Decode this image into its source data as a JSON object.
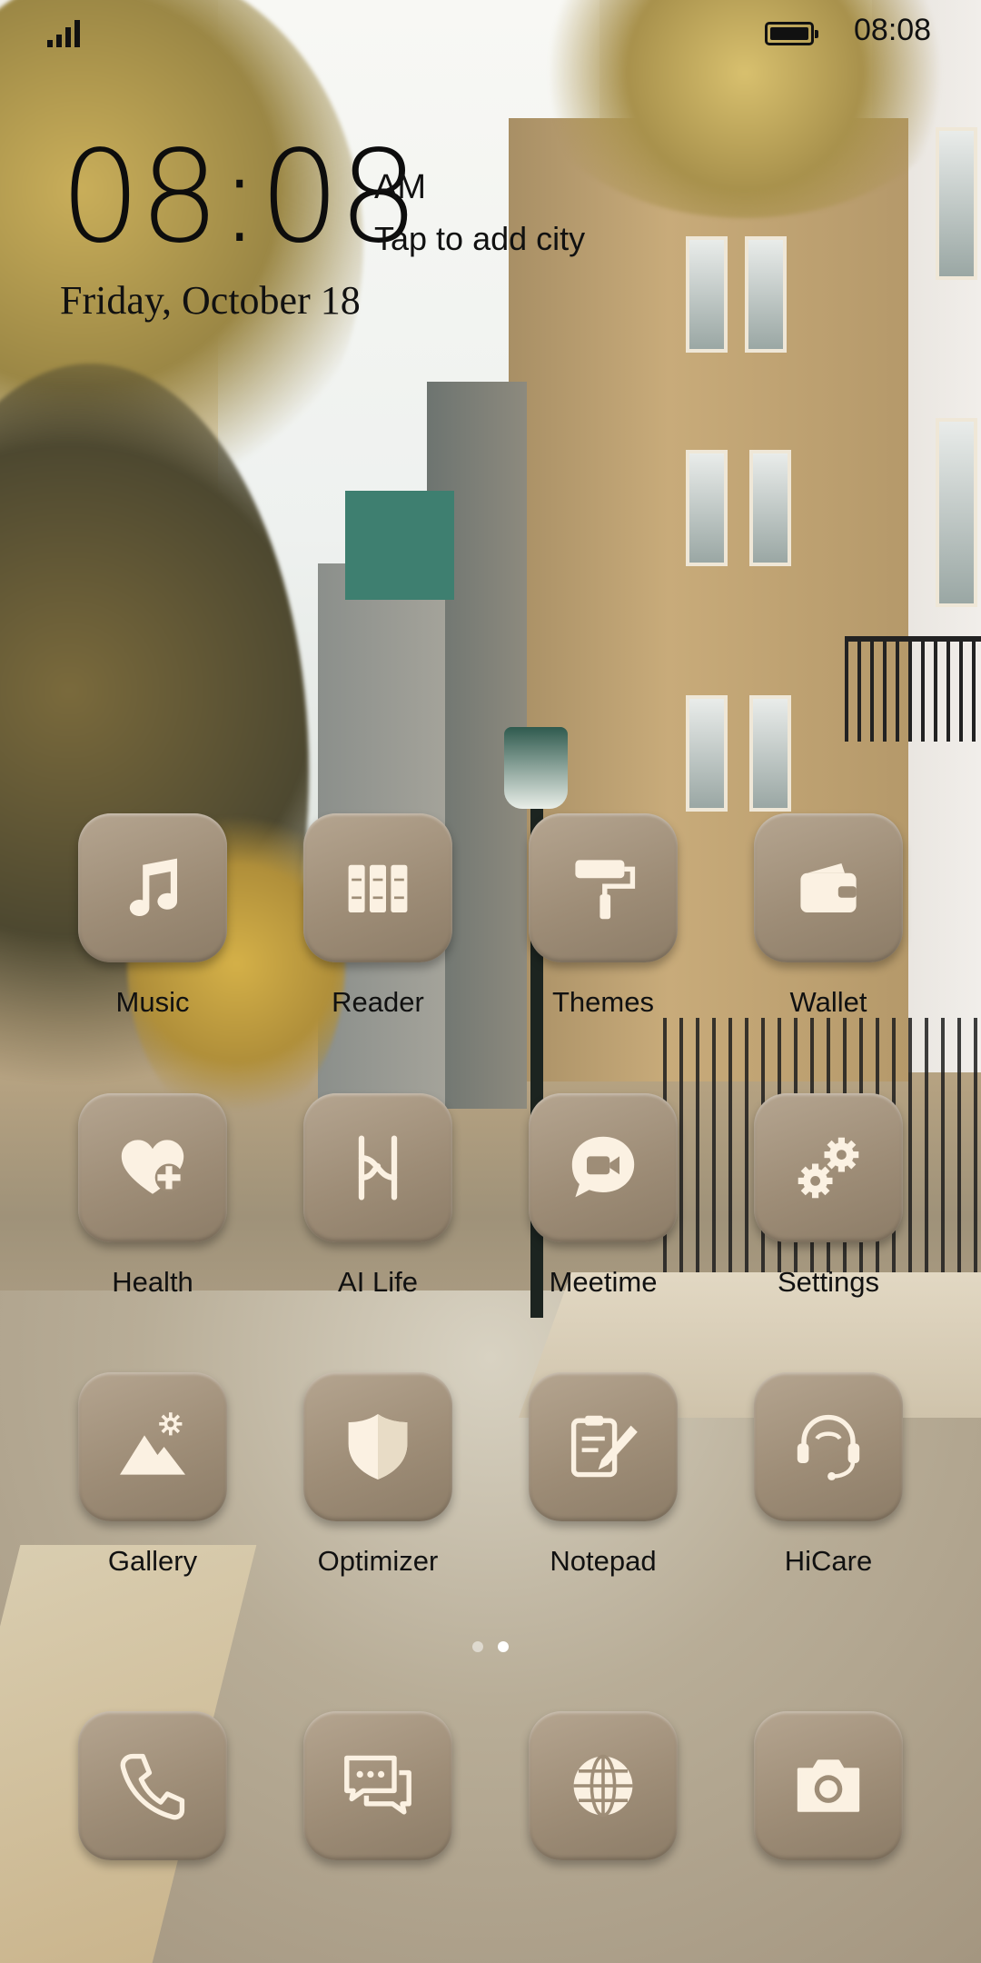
{
  "status_bar": {
    "time": "08:08",
    "battery_percent": 100
  },
  "lock_clock": {
    "time": "08:08",
    "ampm": "AM",
    "city_hint": "Tap to add city",
    "date": "Friday, October 18"
  },
  "apps": [
    {
      "label": "Music",
      "icon": "music-note-icon"
    },
    {
      "label": "Reader",
      "icon": "books-icon"
    },
    {
      "label": "Themes",
      "icon": "paint-roller-icon"
    },
    {
      "label": "Wallet",
      "icon": "wallet-icon"
    },
    {
      "label": "Health",
      "icon": "heart-plus-icon"
    },
    {
      "label": "AI Life",
      "icon": "ai-life-icon"
    },
    {
      "label": "Meetime",
      "icon": "video-chat-icon"
    },
    {
      "label": "Settings",
      "icon": "gears-icon"
    },
    {
      "label": "Gallery",
      "icon": "mountain-image-icon"
    },
    {
      "label": "Optimizer",
      "icon": "shield-icon"
    },
    {
      "label": "Notepad",
      "icon": "clipboard-pencil-icon"
    },
    {
      "label": "HiCare",
      "icon": "headset-icon"
    }
  ],
  "dock": [
    {
      "icon": "phone-icon"
    },
    {
      "icon": "messages-icon"
    },
    {
      "icon": "browser-globe-icon"
    },
    {
      "icon": "camera-icon"
    }
  ],
  "page_indicator": {
    "count": 2,
    "active": 2
  },
  "colors": {
    "icon_tile": "#9e8d77",
    "icon_glyph": "#fbf1e2",
    "text": "#111111"
  }
}
